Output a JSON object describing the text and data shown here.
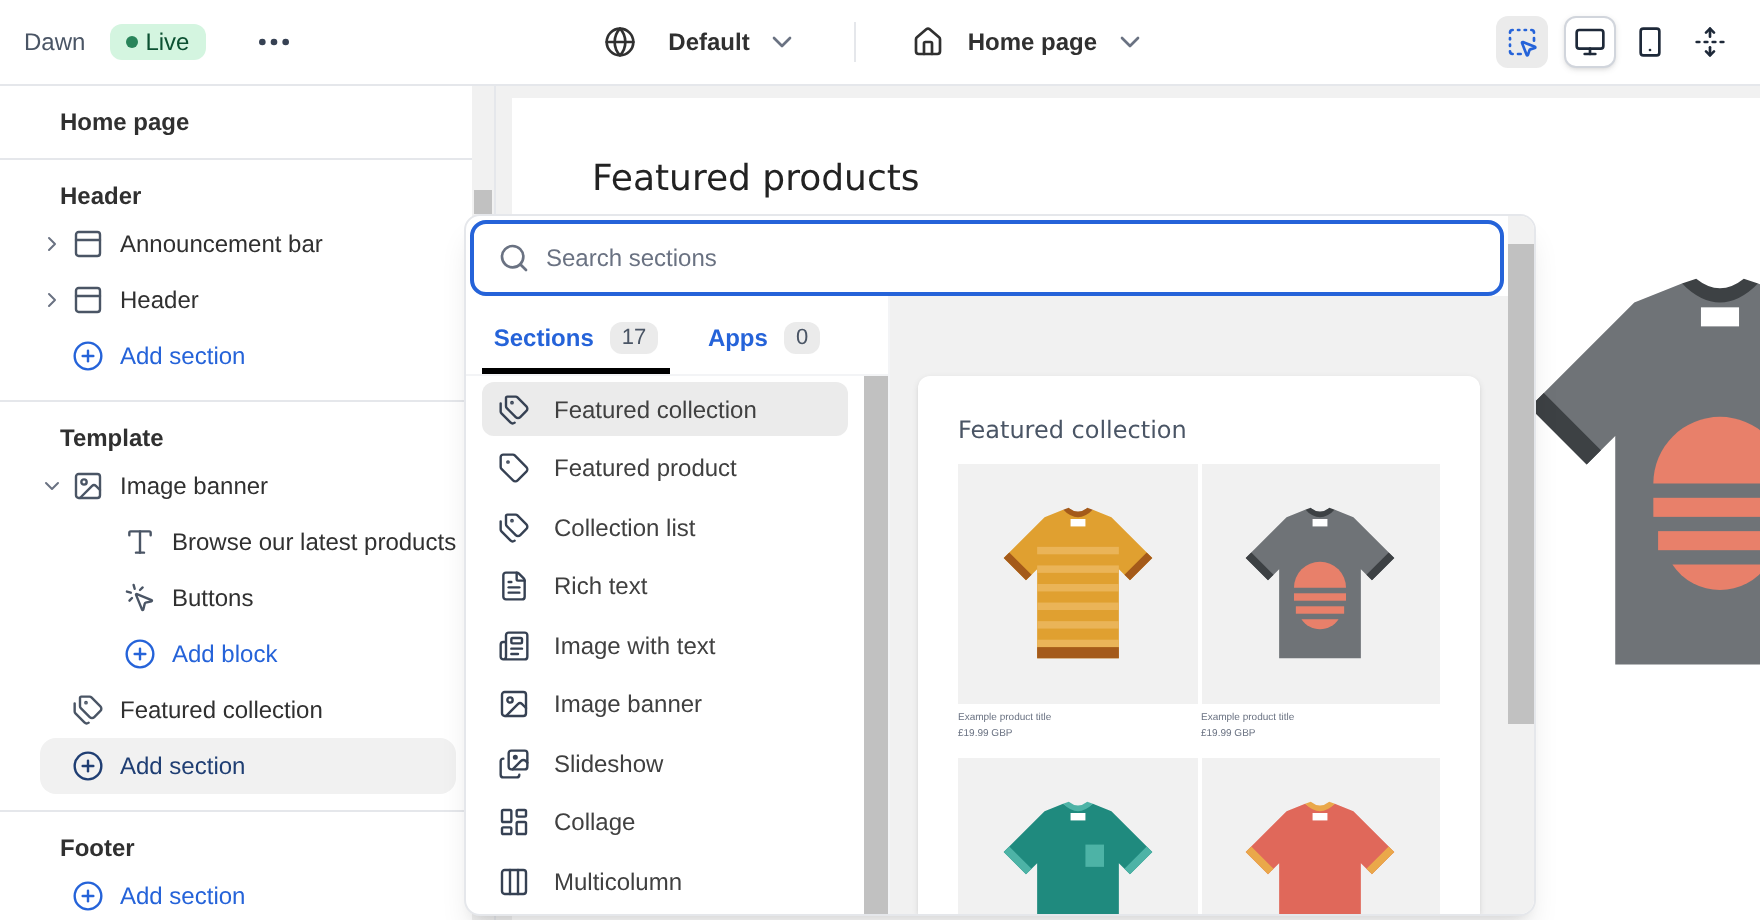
{
  "topbar": {
    "theme_name": "Dawn",
    "status": "Live",
    "theme_selector": "Default",
    "page_selector": "Home page",
    "tools": [
      {
        "kind": "inspect",
        "selected": false,
        "on": true
      },
      {
        "kind": "desktop",
        "selected": true,
        "on": false
      },
      {
        "kind": "mobile",
        "selected": false,
        "on": false
      },
      {
        "kind": "fullwidth",
        "selected": false,
        "on": false
      }
    ]
  },
  "sidebar": {
    "title": "Home page",
    "groups": [
      {
        "heading": "Header",
        "items": [
          {
            "kind": "header_section",
            "label": "Announcement bar",
            "expanded": false
          },
          {
            "kind": "header_section",
            "label": "Header",
            "expanded": false
          },
          {
            "kind": "add",
            "label": "Add section",
            "highlighted": false
          }
        ]
      },
      {
        "heading": "Template",
        "items": [
          {
            "kind": "image_section",
            "label": "Image banner",
            "expanded": true,
            "children": [
              {
                "kind": "text_block",
                "label": "Browse our latest products"
              },
              {
                "kind": "button_block",
                "label": "Buttons"
              },
              {
                "kind": "add",
                "label": "Add block",
                "highlighted": false
              }
            ]
          },
          {
            "kind": "collection_section",
            "label": "Featured collection"
          },
          {
            "kind": "add",
            "label": "Add section",
            "highlighted": true
          }
        ]
      },
      {
        "heading": "Footer",
        "items": [
          {
            "kind": "add",
            "label": "Add section",
            "highlighted": false
          }
        ]
      }
    ]
  },
  "canvas": {
    "heading": "Featured products"
  },
  "picker": {
    "search": {
      "placeholder": "Search sections"
    },
    "tabs": [
      {
        "label": "Sections",
        "count": "17",
        "selected": true
      },
      {
        "label": "Apps",
        "count": "0",
        "selected": false
      }
    ],
    "items": [
      {
        "kind": "tags",
        "label": "Featured collection",
        "selected": true
      },
      {
        "kind": "tag",
        "label": "Featured product",
        "selected": false
      },
      {
        "kind": "tags",
        "label": "Collection list",
        "selected": false
      },
      {
        "kind": "text",
        "label": "Rich text",
        "selected": false
      },
      {
        "kind": "image_text",
        "label": "Image with text",
        "selected": false
      },
      {
        "kind": "image",
        "label": "Image banner",
        "selected": false
      },
      {
        "kind": "slides",
        "label": "Slideshow",
        "selected": false
      },
      {
        "kind": "collage",
        "label": "Collage",
        "selected": false
      },
      {
        "kind": "columns",
        "label": "Multicolumn",
        "selected": false
      }
    ],
    "preview": {
      "title": "Featured collection",
      "products": [
        {
          "kind": "striped",
          "title": "Example product title",
          "price": "£19.99 GBP"
        },
        {
          "kind": "sun",
          "title": "Example product title",
          "price": "£19.99 GBP"
        },
        {
          "kind": "pocket"
        },
        {
          "kind": "plain"
        }
      ]
    }
  }
}
